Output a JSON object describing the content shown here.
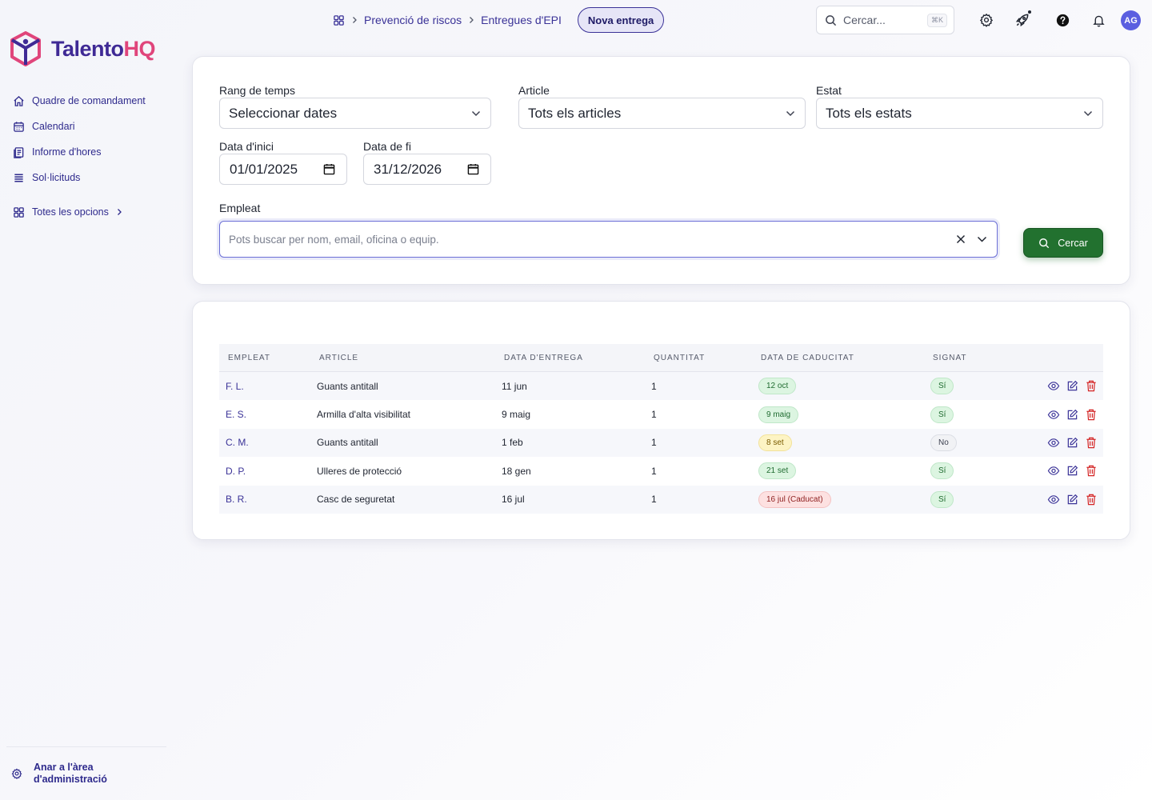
{
  "brand": {
    "name_part1": "Talento",
    "name_part2": "HQ",
    "primary": "#3f2a95",
    "accent": "#e0457b"
  },
  "sidebar": {
    "items": [
      {
        "label": "Quadre de comandament",
        "icon": "home-icon"
      },
      {
        "label": "Calendari",
        "icon": "calendar-icon"
      },
      {
        "label": "Informe d'hores",
        "icon": "report-icon"
      },
      {
        "label": "Sol·licituds",
        "icon": "list-icon"
      }
    ],
    "all_options": "Totes les opcions",
    "admin_link": "Anar a l'àrea d'administració"
  },
  "topbar": {
    "breadcrumb": [
      "Prevenció de riscos",
      "Entregues d'EPI"
    ],
    "new_button": "Nova entrega",
    "search_placeholder": "Cercar...",
    "search_shortcut": "⌘K",
    "avatar_initials": "AG"
  },
  "filters": {
    "range_label": "Rang de temps",
    "range_value": "Seleccionar dates",
    "article_label": "Article",
    "article_value": "Tots els articles",
    "status_label": "Estat",
    "status_value": "Tots els estats",
    "start_label": "Data d'inici",
    "start_value": "01/01/2025",
    "end_label": "Data de fi",
    "end_value": "31/12/2026",
    "employee_label": "Empleat",
    "employee_placeholder": "Pots buscar per nom, email, oficina o equip.",
    "search_button": "Cercar",
    "search_button_color": "#22712f"
  },
  "table": {
    "headers": [
      "EMPLEAT",
      "ARTICLE",
      "DATA D'ENTREGA",
      "QUANTITAT",
      "DATA DE CADUCITAT",
      "SIGNAT"
    ],
    "rows": [
      {
        "employee": "F. L.",
        "article": "Guants antitall",
        "delivery": "11 jun",
        "quantity": "1",
        "expiry": "12 oct",
        "expiry_status": "green",
        "signed": "Sí",
        "signed_status": "green"
      },
      {
        "employee": "E. S.",
        "article": "Armilla d'alta visibilitat",
        "delivery": "9 maig",
        "quantity": "1",
        "expiry": "9 maig",
        "expiry_status": "green",
        "signed": "Sí",
        "signed_status": "green"
      },
      {
        "employee": "C. M.",
        "article": "Guants antitall",
        "delivery": "1 feb",
        "quantity": "1",
        "expiry": "8 set",
        "expiry_status": "yellow",
        "signed": "No",
        "signed_status": "gray"
      },
      {
        "employee": "D. P.",
        "article": "Ulleres de protecció",
        "delivery": "18 gen",
        "quantity": "1",
        "expiry": "21 set",
        "expiry_status": "green",
        "signed": "Sí",
        "signed_status": "green"
      },
      {
        "employee": "B. R.",
        "article": "Casc de seguretat",
        "delivery": "16 jul",
        "quantity": "1",
        "expiry": "16 jul (Caducat)",
        "expiry_status": "red",
        "signed": "Sí",
        "signed_status": "green"
      }
    ]
  }
}
